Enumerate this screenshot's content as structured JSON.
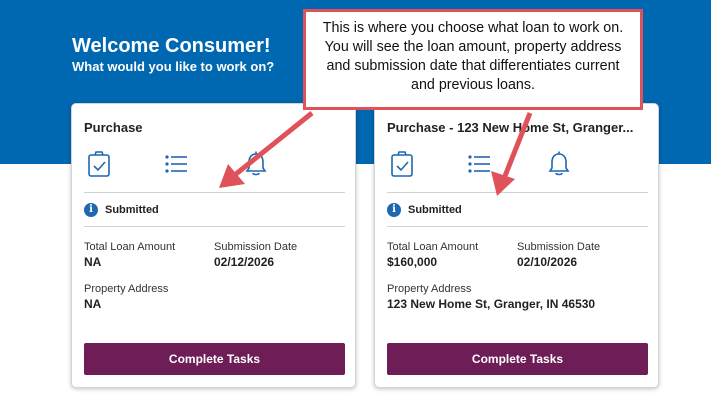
{
  "hero": {
    "title": "Welcome Consumer!",
    "subtitle": "What would you like to work on?"
  },
  "cards": [
    {
      "title": "Purchase",
      "status": "Submitted",
      "total_loan_label": "Total Loan Amount",
      "total_loan_value": "NA",
      "submission_date_label": "Submission Date",
      "submission_date_value": "02/12/2026",
      "property_address_label": "Property Address",
      "property_address_value": "NA",
      "button_label": "Complete Tasks",
      "icons": [
        "clipboard-check-icon",
        "list-icon",
        "bell-icon"
      ]
    },
    {
      "title": "Purchase - 123 New Home St, Granger...",
      "status": "Submitted",
      "total_loan_label": "Total Loan Amount",
      "total_loan_value": "$160,000",
      "submission_date_label": "Submission Date",
      "submission_date_value": "02/10/2026",
      "property_address_label": "Property Address",
      "property_address_value": "123 New Home St, Granger, IN 46530",
      "button_label": "Complete Tasks",
      "icons": [
        "clipboard-check-icon",
        "list-icon",
        "bell-icon"
      ]
    }
  ],
  "annotation": {
    "text": "This is where you choose what loan to work on. You will see the loan amount, property address and submission date that differentiates current and previous loans."
  },
  "colors": {
    "hero_bg": "#0067b1",
    "button_bg": "#6e1d56",
    "icon": "#1f67b2",
    "callout_border": "#e0525a",
    "arrow": "#e0525a"
  }
}
